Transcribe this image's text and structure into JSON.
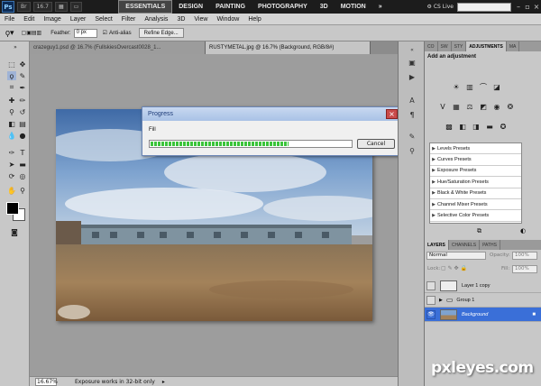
{
  "appbar": {
    "logo": "Ps",
    "zoom": "16.7",
    "workspaces": [
      "ESSENTIALS",
      "DESIGN",
      "PAINTING",
      "PHOTOGRAPHY",
      "3D",
      "MOTION"
    ],
    "more": "»",
    "cs_live": "CS Live"
  },
  "menu": [
    "File",
    "Edit",
    "Image",
    "Layer",
    "Select",
    "Filter",
    "Analysis",
    "3D",
    "View",
    "Window",
    "Help"
  ],
  "options": {
    "feather_label": "Feather:",
    "feather_value": "0 px",
    "antialias_label": "Anti-alias",
    "refine_button": "Refine Edge..."
  },
  "doc_tabs": [
    {
      "label": "crazeguy1.psd @ 16.7% (FullskiesOvercast0028_1..."
    },
    {
      "label": "RUSTYMETAL.jpg @ 16.7% (Background, RGB/8#)"
    }
  ],
  "status": {
    "zoom": "16.67%",
    "message": "Exposure works in 32-bit only"
  },
  "dialog": {
    "title": "Progress",
    "task": "Fill",
    "progress": 0.69,
    "cancel": "Cancel"
  },
  "adjustments": {
    "tabs": [
      "CO",
      "SW",
      "STY",
      "ADJUSTMENTS",
      "MA"
    ],
    "title": "Add an adjustment",
    "presets": [
      "Levels Presets",
      "Curves Presets",
      "Exposure Presets",
      "Hue/Saturation Presets",
      "Black & White Presets",
      "Channel Mixer Presets",
      "Selective Color Presets"
    ]
  },
  "layers": {
    "tabs": [
      "LAYERS",
      "CHANNELS",
      "PATHS"
    ],
    "blend_mode": "Normal",
    "opacity_label": "Opacity:",
    "opacity_value": "100%",
    "lock_label": "Lock:",
    "fill_label": "Fill:",
    "fill_value": "100%",
    "items": [
      {
        "name": "Layer 1 copy"
      },
      {
        "name": "Group 1"
      },
      {
        "name": "Background"
      }
    ]
  },
  "watermark": "pxleyes.com",
  "colors": {
    "progress": "#3ac43a",
    "selected_layer": "#3a6fd8"
  }
}
